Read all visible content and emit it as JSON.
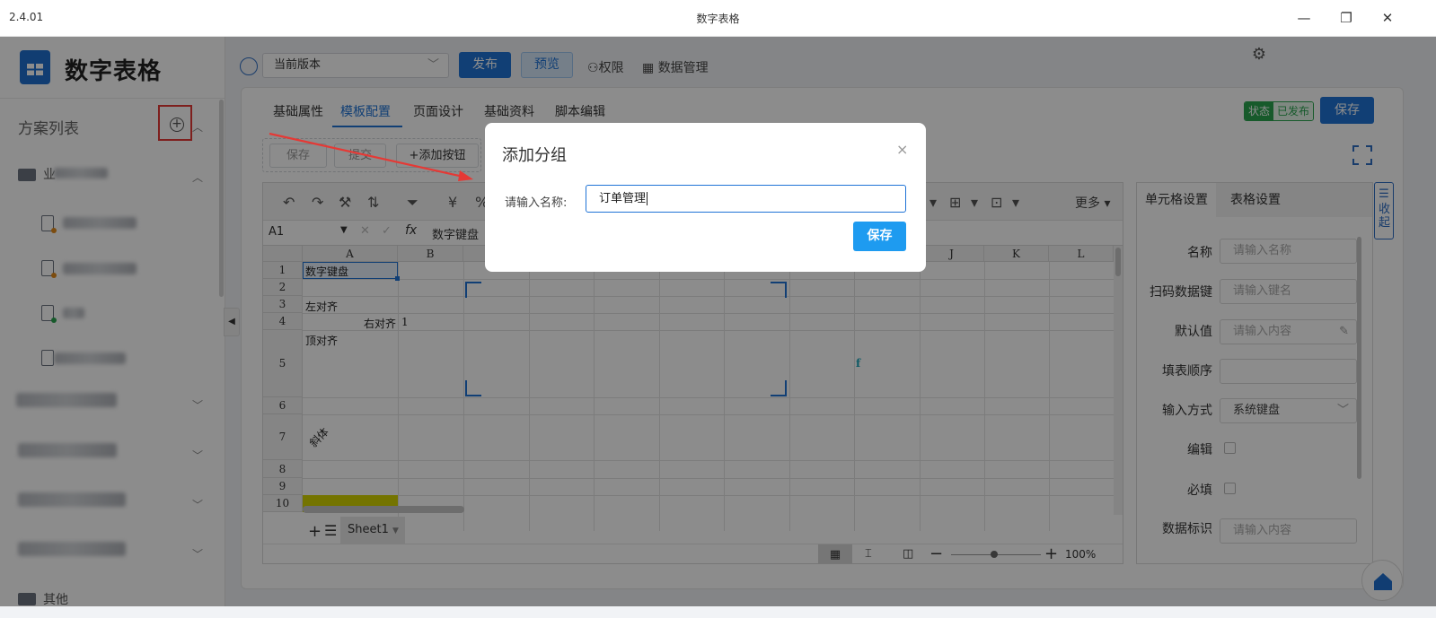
{
  "window": {
    "version": "2.4.01",
    "title": "数字表格"
  },
  "sidebar": {
    "brand": "数字表格",
    "list_title": "方案列表",
    "groups": [
      {
        "label": "业"
      },
      {
        "label": "其他"
      }
    ]
  },
  "topbar": {
    "version_select": "当前版本",
    "publish": "发布",
    "preview": "预览",
    "permission": "权限",
    "data_mgmt": "数据管理"
  },
  "tabs": [
    "基础属性",
    "模板配置",
    "页面设计",
    "基础资料",
    "脚本编辑"
  ],
  "status": {
    "label": "状态",
    "value": "已发布"
  },
  "save_top": "保存",
  "toolbar_buttons": [
    "保存",
    "提交",
    "+添加按钮"
  ],
  "sheet": {
    "more": "更多",
    "cell_ref": "A1",
    "formula": "数字键盘",
    "columns": [
      "A",
      "B",
      "",
      "",
      "",
      "",
      "",
      "",
      "",
      "J",
      "K",
      "L"
    ],
    "rows": [
      "1",
      "2",
      "3",
      "4",
      "5",
      "6",
      "7",
      "8",
      "9",
      "10"
    ],
    "cells": {
      "a1": "数字键盘",
      "a3": "左对齐",
      "a4": "右对齐",
      "b4": "1",
      "a5": "顶对齐",
      "a7": "斜体",
      "i5": "f"
    },
    "sheet_tab": "Sheet1",
    "zoom": "100%"
  },
  "right_panel": {
    "tabs": [
      "单元格设置",
      "表格设置"
    ],
    "fields": [
      {
        "label": "名称",
        "placeholder": "请输入名称"
      },
      {
        "label": "扫码数据键",
        "placeholder": "请输入键名"
      },
      {
        "label": "默认值",
        "placeholder": "请输入内容"
      },
      {
        "label": "填表顺序",
        "placeholder": ""
      },
      {
        "label": "输入方式",
        "value": "系统键盘"
      },
      {
        "label": "编辑"
      },
      {
        "label": "必填"
      },
      {
        "label": "数据标识",
        "placeholder": "请输入内容"
      }
    ],
    "collapse": "收起"
  },
  "modal": {
    "title": "添加分组",
    "label": "请输入名称:",
    "value": "订单管理",
    "save": "保存",
    "close": "×"
  },
  "colors": {
    "accent": "#1f73d6",
    "status": "#2aa54f",
    "highlight": "#e53935"
  }
}
